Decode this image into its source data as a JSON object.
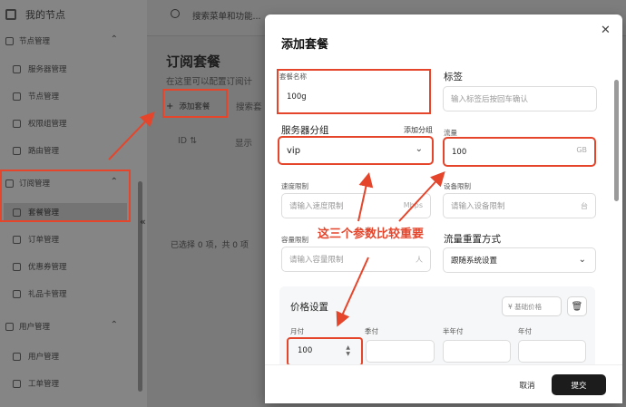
{
  "sidebar": {
    "brand": "我的节点",
    "groups": {
      "node": "节点管理",
      "subscription": "订阅管理",
      "user": "用户管理"
    },
    "items": {
      "server": "服务器管理",
      "node": "节点管理",
      "permission": "权限组管理",
      "route": "路由管理",
      "plan": "套餐管理",
      "order": "订单管理",
      "coupon": "优惠券管理",
      "giftcard": "礼品卡管理",
      "users": "用户管理",
      "ticket": "工单管理"
    }
  },
  "topbar": {
    "search_placeholder": "搜索菜单和功能..."
  },
  "main": {
    "title": "订阅套餐",
    "desc": "在这里可以配置订阅计",
    "add_button": "添加套餐",
    "filter_placeholder": "搜索套",
    "columns": {
      "id": "ID ⇅",
      "show": "显示"
    },
    "footer": "已选择 0 项，共 0 项"
  },
  "modal": {
    "title": "添加套餐",
    "name": {
      "label": "套餐名称",
      "value": "100g"
    },
    "tags": {
      "label": "标签",
      "placeholder": "输入标签后按回车确认"
    },
    "server_group": {
      "label": "服务器分组",
      "link": "添加分组",
      "value": "vip"
    },
    "traffic": {
      "label": "流量",
      "value": "100",
      "unit": "GB"
    },
    "speed": {
      "label": "速度限制",
      "placeholder": "请输入速度限制",
      "unit": "Mbps"
    },
    "device": {
      "label": "设备限制",
      "placeholder": "请输入设备限制",
      "unit": "台"
    },
    "capacity": {
      "label": "容量限制",
      "placeholder": "请输入容量限制",
      "unit": "人"
    },
    "reset": {
      "label": "流量重置方式",
      "value": "跟随系统设置"
    },
    "price": {
      "title": "价格设置",
      "base_placeholder": "¥ 基础价格",
      "monthly_label": "月付",
      "monthly_value": "100",
      "quarterly_label": "季付",
      "half_year_label": "半年付",
      "yearly_label": "年付"
    },
    "cancel": "取消",
    "submit": "提交"
  },
  "annotation": {
    "callout": "这三个参数比较重要"
  },
  "colors": {
    "annotation_red": "#e5452b",
    "submit_bg": "#1c1c1c"
  }
}
